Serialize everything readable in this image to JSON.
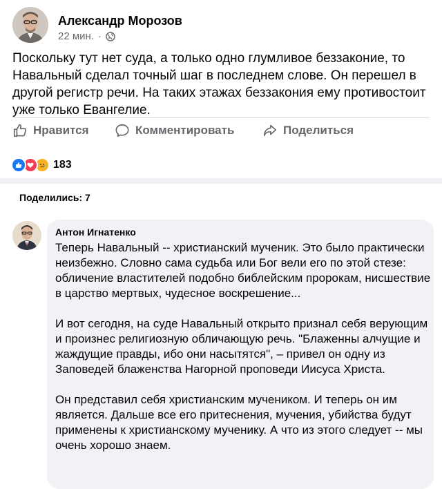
{
  "post": {
    "author": "Александр Морозов",
    "time": "22 мин.",
    "separator": "·",
    "text": "Поскольку тут нет суда, а только одно глумливое беззаконие, то Навальный сделал точный шаг в последнем слове. Он перешел в другой регистр речи. На таких этажах беззакония ему противостоит уже только Евангелие."
  },
  "actions": {
    "like": "Нравится",
    "comment": "Комментировать",
    "share": "Поделиться"
  },
  "reactions": {
    "count": "183",
    "types": [
      "like-icon",
      "love-icon",
      "sad-icon"
    ]
  },
  "shares": {
    "label": "Поделились: 7"
  },
  "comment": {
    "author": "Антон Игнатенко",
    "paragraphs": [
      "Теперь Навальный -- христианский мученик. Это было практически неизбежно. Словно сама судьба или Бог вели его по этой стезе: обличение властителей подобно библейским пророкам, нисшествие в царство мертвых, чудесное воскрешение...",
      "И вот сегодня, на суде Навальный открыто признал себя верующим и произнес религиозную обличающую речь. \"Блаженны алчущие и жаждущие правды, ибо они насытятся\", – привел он одну из Заповедей блаженства Нагорной проповеди Иисуса Христа.",
      "Он представил себя христианским мучеником. И теперь он им является. Дальше все его притеснения, мучения, убийства будут применены к христианскому мученику. А что из этого следует -- мы очень хорошо знаем."
    ]
  },
  "colors": {
    "secondary_text": "#65676b",
    "like_blue": "#1877f2",
    "love_red": "#f33e58",
    "sad_yellow": "#f7b125",
    "comment_bg": "#f0f2f5"
  }
}
